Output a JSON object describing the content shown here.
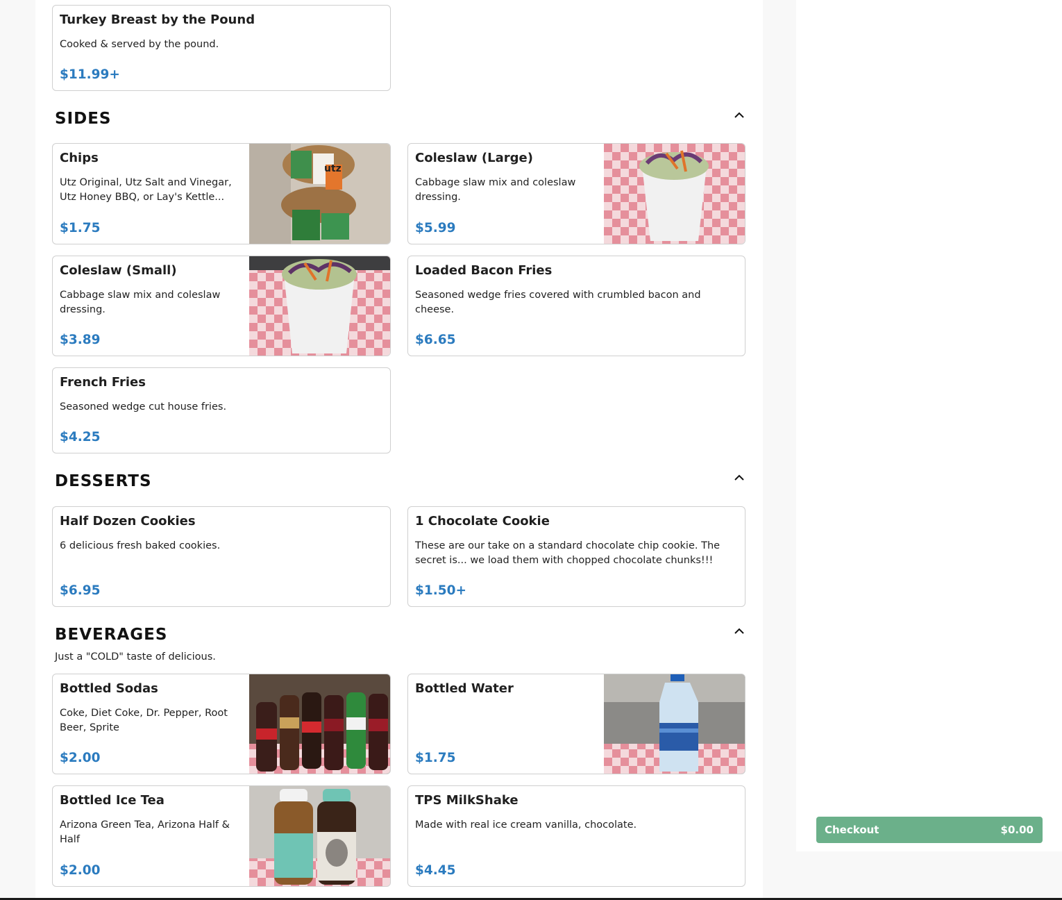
{
  "sections": {
    "sides": {
      "title": "SIDES",
      "toggle_icon": "chevron-up-icon"
    },
    "desserts": {
      "title": "DESSERTS",
      "toggle_icon": "chevron-up-icon"
    },
    "beverages": {
      "title": "BEVERAGES",
      "subtitle": "Just a \"COLD\" taste of delicious.",
      "toggle_icon": "chevron-up-icon"
    }
  },
  "items": {
    "turkey": {
      "name": "Turkey Breast by the Pound",
      "desc": "Cooked & served by the pound.",
      "price": "$11.99+"
    },
    "chips": {
      "name": "Chips",
      "desc": "Utz Original, Utz Salt and Vinegar, Utz Honey BBQ, or Lay's Kettle...",
      "price": "$1.75"
    },
    "coleslaw_large": {
      "name": "Coleslaw (Large)",
      "desc": "Cabbage slaw mix and coleslaw dressing.",
      "price": "$5.99"
    },
    "coleslaw_small": {
      "name": "Coleslaw (Small)",
      "desc": "Cabbage slaw mix and coleslaw dressing.",
      "price": "$3.89"
    },
    "loaded_fries": {
      "name": "Loaded Bacon Fries",
      "desc": "Seasoned wedge fries covered with crumbled bacon and cheese.",
      "price": "$6.65"
    },
    "french_fries": {
      "name": "French Fries",
      "desc": "Seasoned wedge cut house fries.",
      "price": "$4.25"
    },
    "half_dozen": {
      "name": "Half Dozen Cookies",
      "desc": "6 delicious fresh baked cookies.",
      "price": "$6.95"
    },
    "choc_cookie": {
      "name": "1 Chocolate Cookie",
      "desc": "These are our take on a standard chocolate chip cookie. The secret is... we load them with chopped chocolate chunks!!!",
      "price": "$1.50+"
    },
    "bottled_sodas": {
      "name": "Bottled Sodas",
      "desc": "Coke, Diet Coke, Dr. Pepper, Root Beer, Sprite",
      "price": "$2.00"
    },
    "bottled_water": {
      "name": "Bottled Water",
      "desc": "",
      "price": "$1.75"
    },
    "ice_tea": {
      "name": "Bottled Ice Tea",
      "desc": "Arizona Green Tea, Arizona Half & Half",
      "price": "$2.00"
    },
    "milkshake": {
      "name": "TPS MilkShake",
      "desc": "Made with real ice cream vanilla, chocolate.",
      "price": "$4.45"
    }
  },
  "cart": {
    "checkout_label": "Checkout",
    "total": "$0.00"
  },
  "colors": {
    "price": "#2b7bbf",
    "checkout": "#6bb08a"
  }
}
